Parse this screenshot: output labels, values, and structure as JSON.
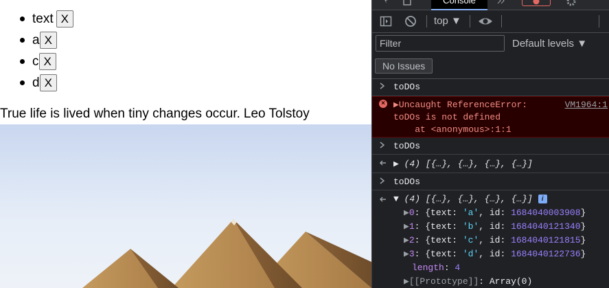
{
  "page": {
    "todos": [
      {
        "text": "text",
        "button": "X"
      },
      {
        "text": "a",
        "button": "X"
      },
      {
        "text": "c",
        "button": "X"
      },
      {
        "text": "d",
        "button": "X"
      }
    ],
    "quote": {
      "text": "True life is lived when tiny changes occur.",
      "author": "Leo Tolstoy"
    }
  },
  "devtools": {
    "active_tab": "Console",
    "toolbar": {
      "context": "top ▼"
    },
    "filter": {
      "placeholder": "Filter",
      "value": ""
    },
    "levels": "Default levels ▼",
    "issues_button": "No Issues",
    "messages": {
      "m1": {
        "input": "toDOs"
      },
      "error": {
        "line1": "▶Uncaught ReferenceError:",
        "line2": "toDOs is not defined",
        "line3": "    at <anonymous>:1:1",
        "source": "VM1964:1"
      },
      "m2": {
        "input": "toDOs"
      },
      "m3": {
        "output": "▶ (4) [{…}, {…}, {…}, {…}]"
      },
      "m4": {
        "input": "toDOs"
      },
      "m5": {
        "header": "▼ (4) [{…}, {…}, {…}, {…}]",
        "entries": [
          {
            "index": "0",
            "text": "'a'",
            "id": "1684040003908"
          },
          {
            "index": "1",
            "text": "'b'",
            "id": "1684040121340"
          },
          {
            "index": "2",
            "text": "'c'",
            "id": "1684040121815"
          },
          {
            "index": "3",
            "text": "'d'",
            "id": "1684040122736"
          }
        ],
        "length_label": "length",
        "length_value": "4",
        "prototype": "[[Prototype]]",
        "prototype_value": "Array(0)"
      }
    },
    "colors": {
      "background": "#202124",
      "error_bg": "#290000",
      "error_text": "#f28b82",
      "number": "#9980ff",
      "string": "#5cd5fb",
      "key": "#c58af9"
    }
  }
}
